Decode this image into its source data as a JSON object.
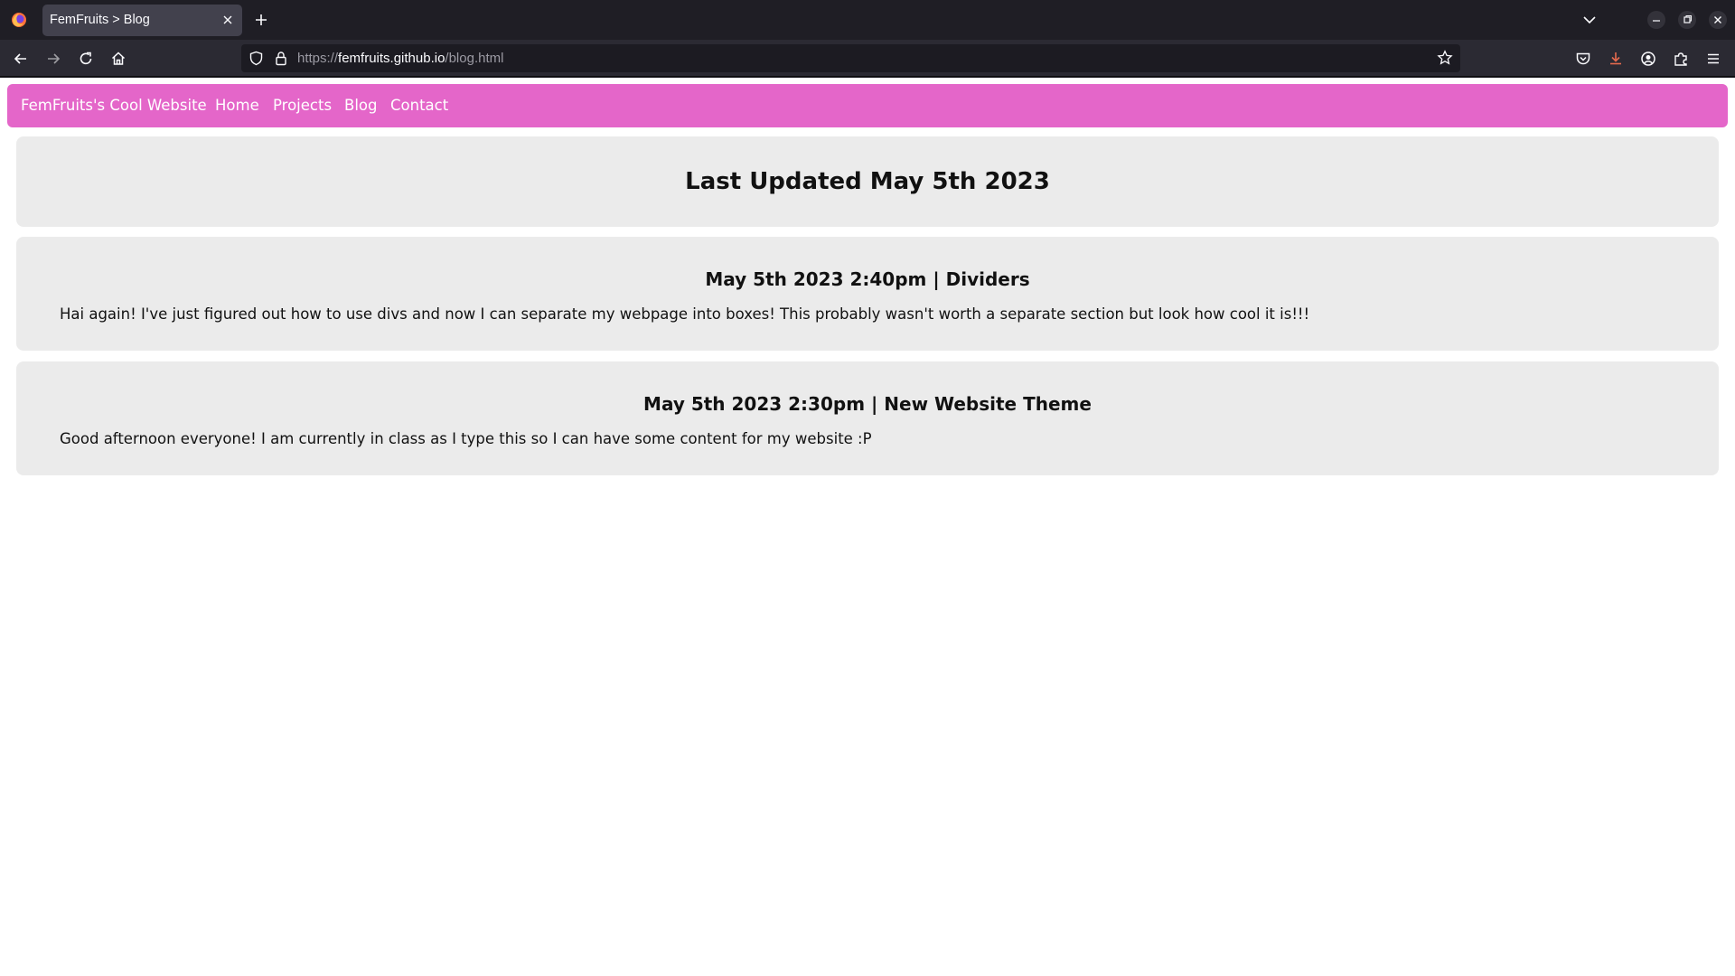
{
  "browser": {
    "tab": {
      "title": "FemFruits > Blog"
    },
    "url": {
      "scheme": "https://",
      "host": "femfruits.github.io",
      "path": "/blog.html"
    },
    "colors": {
      "chrome": "#1f1e25",
      "toolbar": "#2b2a33",
      "download_accent": "#e66a4e"
    }
  },
  "site": {
    "brand": "FemFruits's Cool Website",
    "nav": {
      "home": "Home",
      "projects": "Projects",
      "blog": "Blog",
      "contact": "Contact"
    },
    "nav_color": "#e466c9",
    "box_color": "#ebebeb"
  },
  "main": {
    "updated": "Last Updated May 5th 2023",
    "posts": [
      {
        "title": "May 5th 2023 2:40pm | Dividers",
        "body": "Hai again! I've just figured out how to use divs and now I can separate my webpage into boxes! This probably wasn't worth a separate section but look how cool it is!!!"
      },
      {
        "title": "May 5th 2023 2:30pm | New Website Theme",
        "body": "Good afternoon everyone! I am currently in class as I type this so I can have some content for my website :P"
      }
    ]
  }
}
